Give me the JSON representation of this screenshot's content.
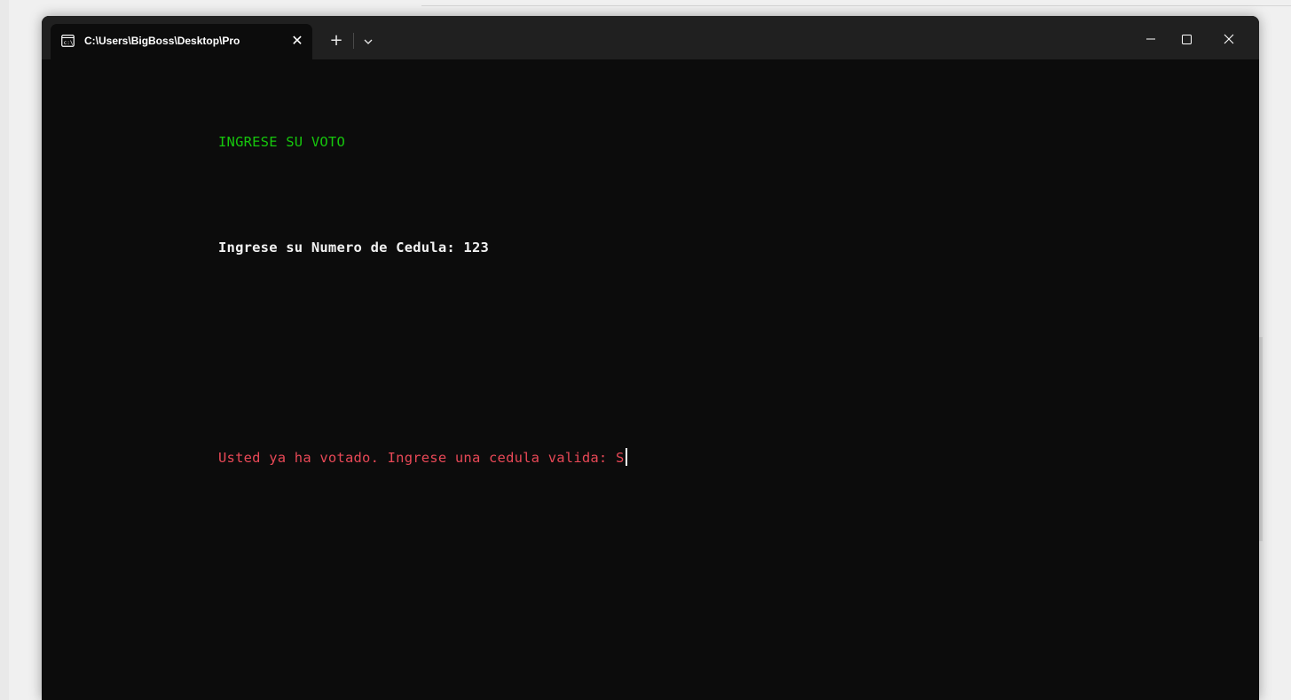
{
  "window": {
    "tab_title": "C:\\Users\\BigBoss\\Desktop\\Pro",
    "tab_close_glyph": "✕",
    "new_tab_glyph": "+",
    "icons": [
      "terminal-icon",
      "close-icon",
      "plus-icon",
      "chevron-down-icon",
      "minimize-icon",
      "maximize-icon",
      "window-close-icon"
    ]
  },
  "terminal": {
    "lines": {
      "title": "INGRESE SU VOTO",
      "prompt": "Ingrese su Numero de Cedula: 123",
      "error": "Usted ya ha votado. Ingrese una cedula valida: S"
    },
    "colors": {
      "background": "#0c0c0c",
      "title": "#16c60c",
      "prompt": "#f2f2f2",
      "error": "#e74856"
    }
  }
}
